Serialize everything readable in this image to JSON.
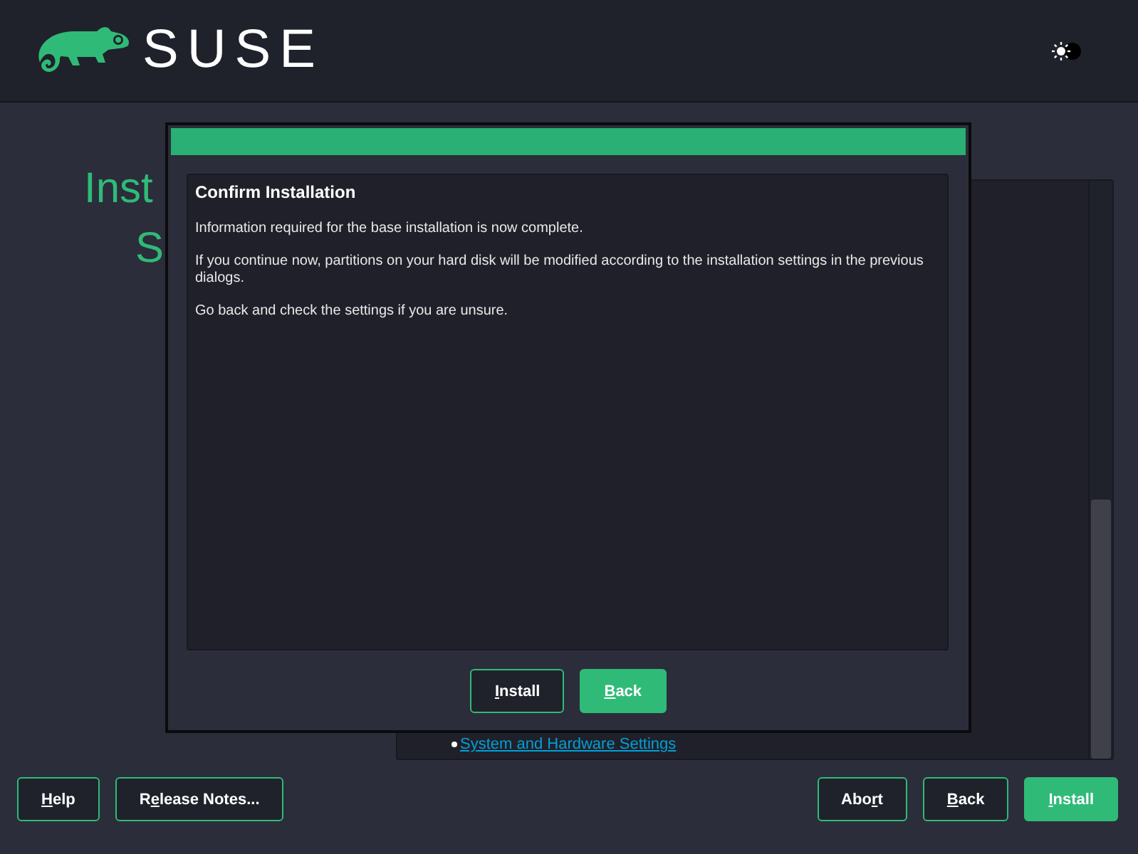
{
  "header": {
    "brand": "SUSE"
  },
  "page_title": {
    "lines": [
      "Inst",
      "S"
    ]
  },
  "summary": {
    "link": "System and Hardware Settings"
  },
  "dialog": {
    "heading": "Confirm Installation",
    "paragraphs": [
      "Information required for the base installation is now complete.",
      "If you continue now, partitions on your hard disk will be modified according to the installation settings in the previous dialogs.",
      "Go back and check the settings if you are unsure."
    ],
    "buttons": [
      {
        "key": "I",
        "post": "nstall",
        "primary": false
      },
      {
        "key": "B",
        "post": "ack",
        "primary": true
      }
    ]
  },
  "footer": {
    "left": [
      {
        "key": "H",
        "post": "elp",
        "primary": false
      },
      {
        "pre": "R",
        "key": "e",
        "post": "lease Notes...",
        "primary": false
      }
    ],
    "right": [
      {
        "pre": "Abo",
        "key": "r",
        "post": "t",
        "primary": false
      },
      {
        "key": "B",
        "post": "ack",
        "primary": false
      },
      {
        "key": "I",
        "post": "nstall",
        "primary": true
      }
    ]
  }
}
